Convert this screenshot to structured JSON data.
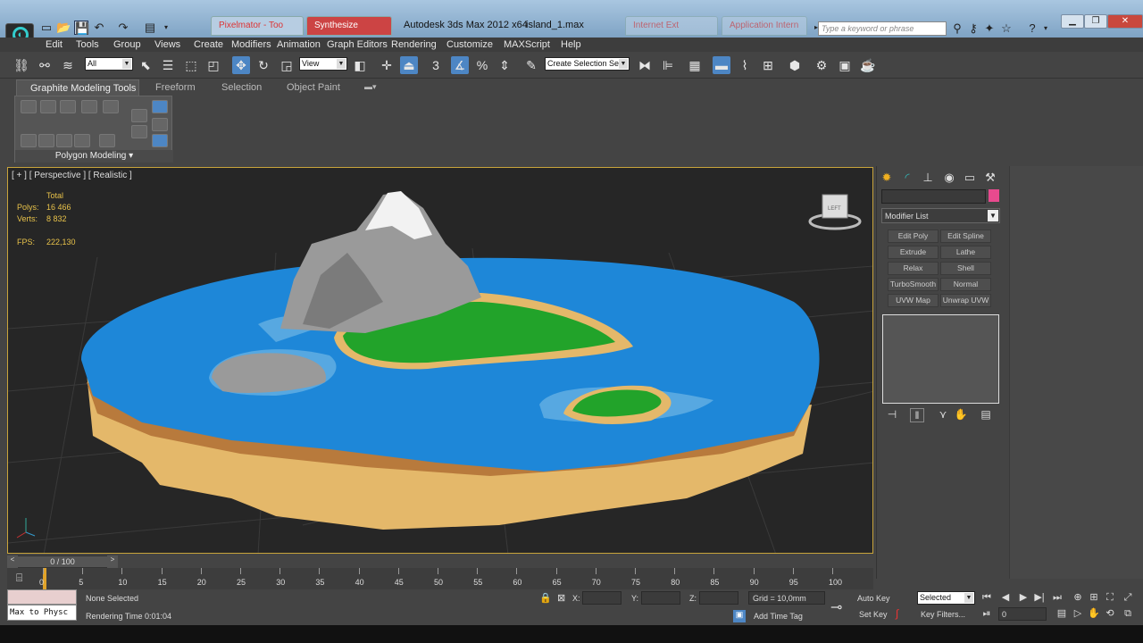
{
  "window": {
    "app_title": "Autodesk 3ds Max  2012 x64",
    "file_title": "island_1.max",
    "background_tabs": [
      "Pixelmator - Too",
      "Synthesize",
      "Internet Ext",
      "Application Intern"
    ]
  },
  "quick_access": [
    "new-icon",
    "open-icon",
    "save-icon",
    "undo-icon",
    "redo-icon",
    "project-icon"
  ],
  "search": {
    "placeholder": "Type a keyword or phrase"
  },
  "menu": [
    "Edit",
    "Tools",
    "Group",
    "Views",
    "Create",
    "Modifiers",
    "Animation",
    "Graph Editors",
    "Rendering",
    "Customize",
    "MAXScript",
    "Help"
  ],
  "toolbar": {
    "selection_filter": "All",
    "ref_coord": "View",
    "named_selection": "Create Selection Se",
    "snaps_label": "3",
    "angle_snap": "%"
  },
  "ribbon": {
    "tabs": [
      "Graphite Modeling Tools",
      "Freeform",
      "Selection",
      "Object Paint"
    ],
    "panel_label": "Polygon Modeling"
  },
  "viewport": {
    "label": "[ + ] [ Perspective ] [ Realistic ]",
    "stats_header": "Total",
    "polys_label": "Polys:",
    "polys": "16 466",
    "verts_label": "Verts:",
    "verts": "8 832",
    "fps_label": "FPS:",
    "fps": "222,130",
    "viewcube_label": "LEFT",
    "colors": {
      "water": "#1e87d8",
      "grass": "#22a32a",
      "rock": "#9a9a9a",
      "snow": "#f2f2f2",
      "sand": "#e4b86a",
      "earth": "#b87a3c",
      "grid": "#3a3a3a"
    }
  },
  "command_panel": {
    "modifier_list": "Modifier List",
    "buttons": [
      "Edit Poly",
      "Edit Spline",
      "Extrude",
      "Lathe",
      "Relax",
      "Shell",
      "TurboSmooth",
      "Normal",
      "UVW Map",
      "Unwrap UVW"
    ],
    "color_swatch": "#e84a8e"
  },
  "timeline": {
    "slider": "0 / 100",
    "ticks": [
      "0",
      "5",
      "10",
      "15",
      "20",
      "25",
      "30",
      "35",
      "40",
      "45",
      "50",
      "55",
      "60",
      "65",
      "70",
      "75",
      "80",
      "85",
      "90",
      "95",
      "100"
    ]
  },
  "status": {
    "maxscript": "Max to Physc",
    "selected": "None Selected",
    "render_time": "Rendering Time  0:01:04",
    "x_label": "X:",
    "y_label": "Y:",
    "z_label": "Z:",
    "grid": "Grid = 10,0mm",
    "add_time_tag": "Add Time Tag",
    "auto_key": "Auto Key",
    "set_key": "Set Key",
    "key_mode": "Selected",
    "key_filters": "Key Filters...",
    "frame": "0"
  }
}
